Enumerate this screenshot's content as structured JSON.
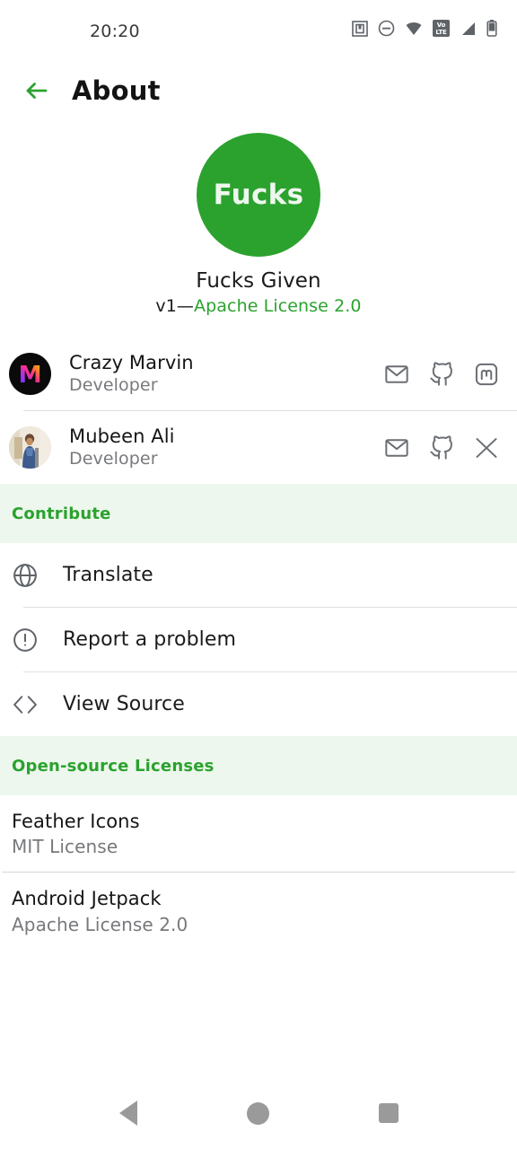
{
  "status_bar": {
    "time": "20:20",
    "icons": [
      "nfc-icon",
      "do-not-disturb-icon",
      "wifi-icon",
      "volte-icon",
      "signal-icon",
      "battery-icon"
    ],
    "volte_top": "Vo",
    "volte_bottom": "LTE"
  },
  "app_bar": {
    "back_icon": "back-arrow-icon",
    "title": "About"
  },
  "identity": {
    "logo_text": "Fucks",
    "logo_color": "#2ba22e",
    "app_name": "Fucks Given",
    "version_prefix": "v1—",
    "license": "Apache License 2.0",
    "license_color": "#2ba22e"
  },
  "developers": [
    {
      "name": "Crazy Marvin",
      "role": "Developer",
      "avatar": "marvin-gradient-m-avatar",
      "links": [
        "mail-icon",
        "github-icon",
        "mastodon-icon"
      ]
    },
    {
      "name": "Mubeen Ali",
      "role": "Developer",
      "avatar": "mubeen-photo-avatar",
      "links": [
        "mail-icon",
        "github-icon",
        "x-twitter-icon"
      ]
    }
  ],
  "contribute": {
    "header": "Contribute",
    "items": [
      {
        "label": "Translate",
        "icon": "globe-icon"
      },
      {
        "label": "Report a problem",
        "icon": "alert-circle-icon"
      },
      {
        "label": "View Source",
        "icon": "code-brackets-icon"
      }
    ]
  },
  "licenses": {
    "header": "Open-source Licenses",
    "items": [
      {
        "name": "Feather Icons",
        "license": "MIT License"
      },
      {
        "name": "Android Jetpack",
        "license": "Apache License 2.0"
      }
    ]
  },
  "nav_bar": {
    "back": "nav-back-icon",
    "home": "nav-home-icon",
    "recents": "nav-recents-icon"
  },
  "theme": {
    "accent": "#2ba22e",
    "section_bg": "#edf7ed",
    "text": "#151515",
    "muted": "#77797c"
  }
}
